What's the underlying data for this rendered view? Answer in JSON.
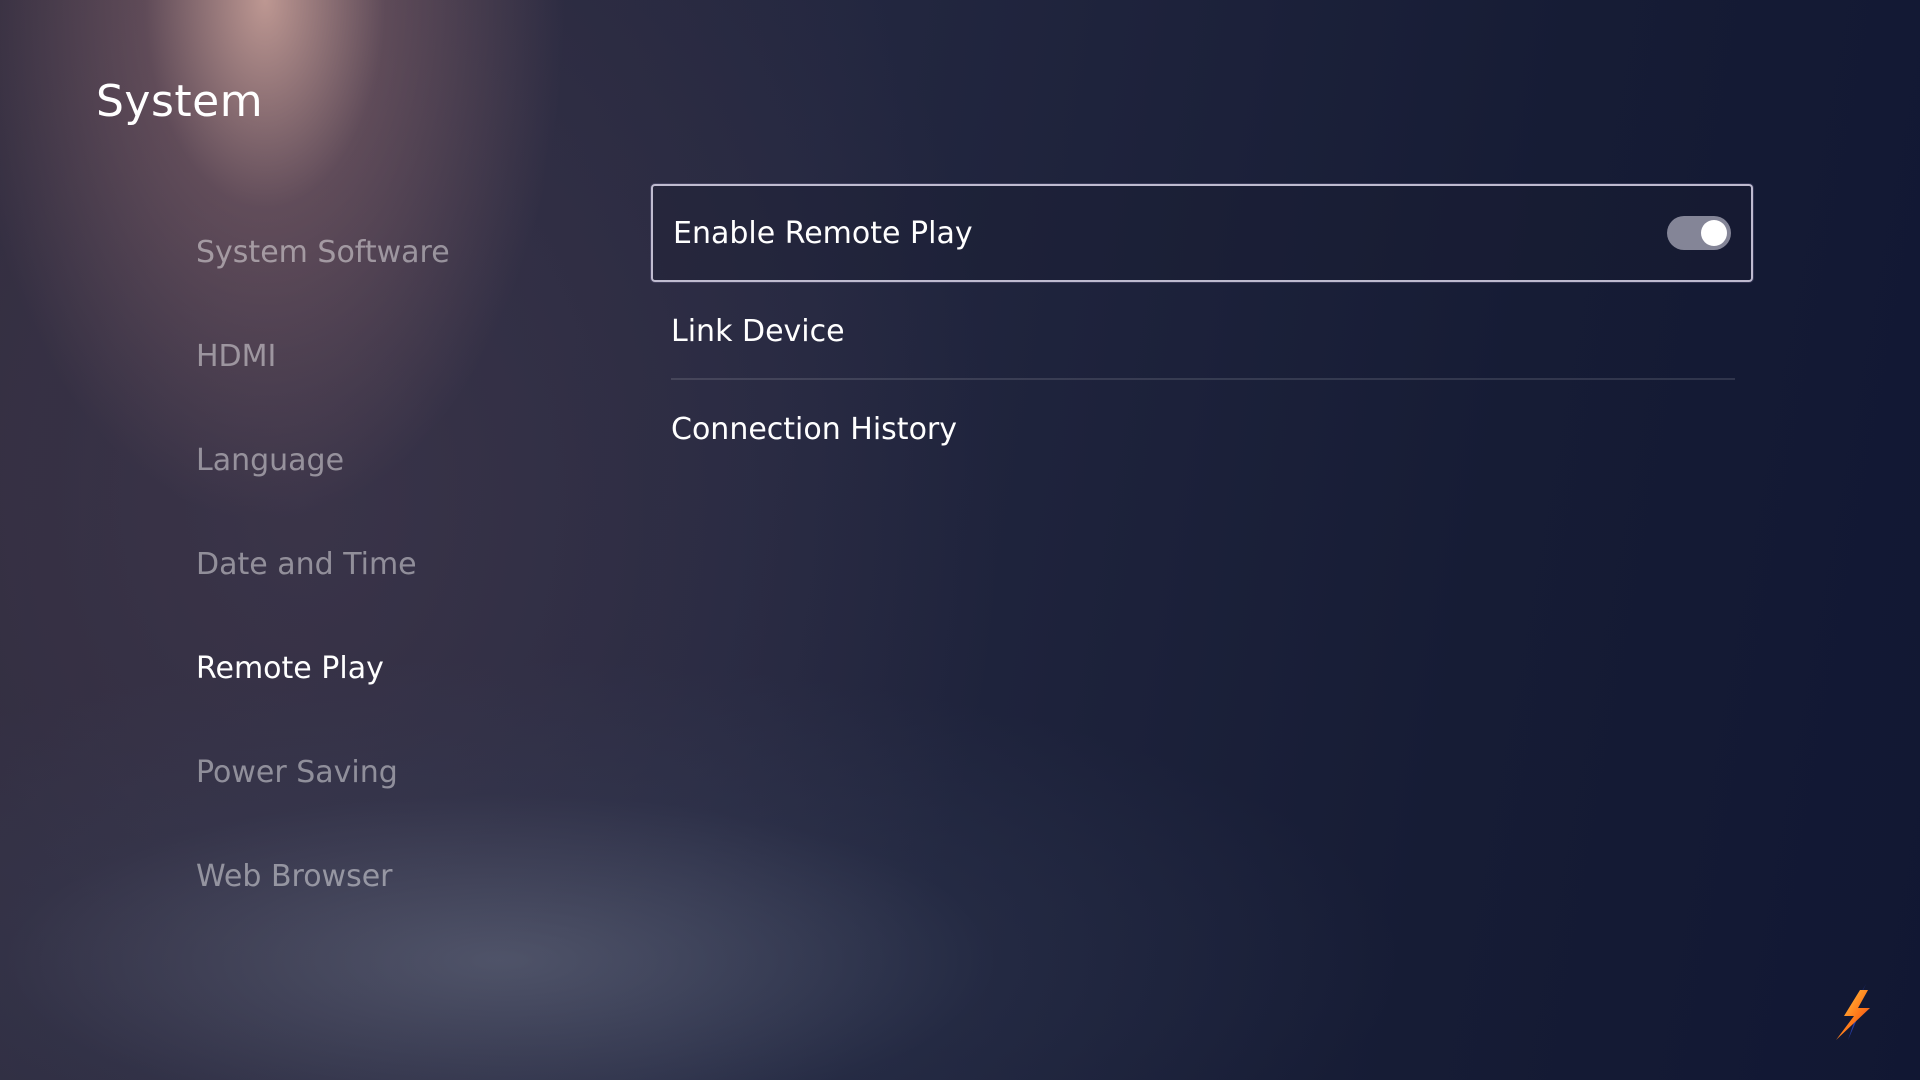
{
  "header": {
    "title": "System"
  },
  "sidebar": {
    "items": [
      {
        "label": "System Software"
      },
      {
        "label": "HDMI"
      },
      {
        "label": "Language"
      },
      {
        "label": "Date and Time"
      },
      {
        "label": "Remote Play",
        "selected": true
      },
      {
        "label": "Power Saving"
      },
      {
        "label": "Web Browser"
      }
    ]
  },
  "main": {
    "options": [
      {
        "label": "Enable Remote Play",
        "toggle": "on"
      },
      {
        "label": "Link Device"
      },
      {
        "label": "Connection History"
      }
    ]
  },
  "icons": {
    "corner_logo": "lightning-logo-icon"
  },
  "colors": {
    "text_primary": "#ffffff",
    "text_muted": "rgba(255,255,255,0.45)",
    "background_dark": "#111733",
    "toggle_track": "#a9a9b8",
    "toggle_knob": "#ffffff"
  }
}
